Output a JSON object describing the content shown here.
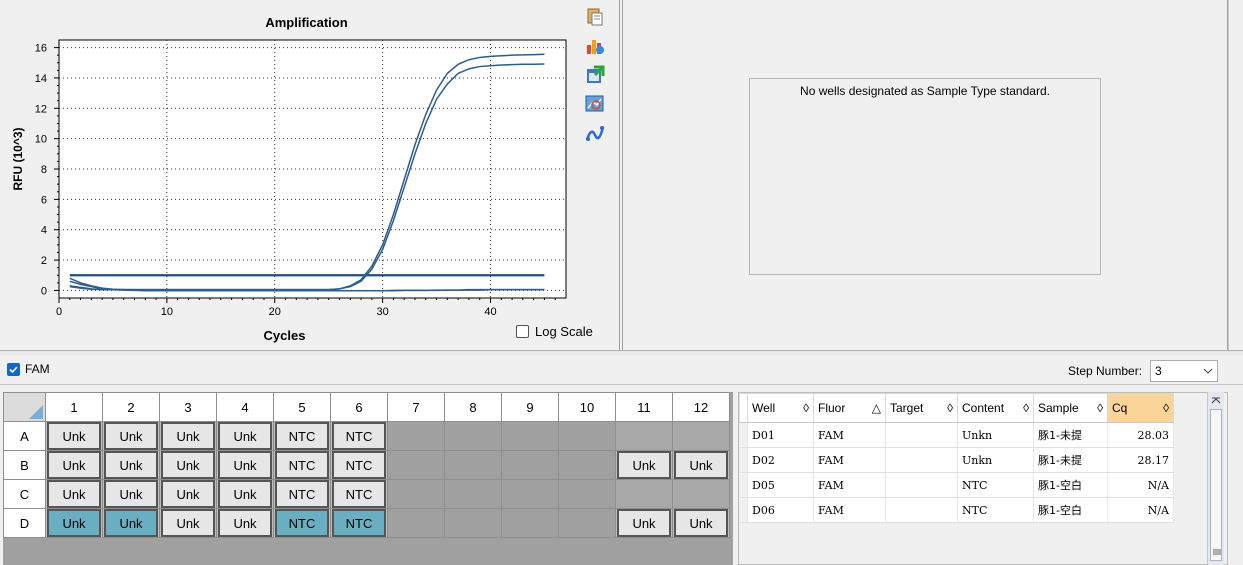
{
  "chart": {
    "log_scale_label": "Log Scale",
    "log_scale_checked": false,
    "tools": [
      "copy-icon",
      "chart-settings-icon",
      "export-icon",
      "zoom-icon",
      "trace-style-icon"
    ]
  },
  "chart_data": {
    "type": "line",
    "title": "Amplification",
    "xlabel": "Cycles",
    "ylabel": "RFU (10^3)",
    "xlim": [
      0,
      47
    ],
    "ylim": [
      -0.5,
      16.5
    ],
    "xticks": [
      0,
      10,
      20,
      30,
      40
    ],
    "yticks": [
      0,
      2,
      4,
      6,
      8,
      10,
      12,
      14,
      16
    ],
    "grid": true,
    "threshold": 1.0,
    "x_range": [
      1,
      45
    ],
    "series": [
      {
        "values": [
          0.25,
          0.15,
          0.08,
          0.05,
          0.05,
          0.05,
          0.05,
          0.05,
          0.05,
          0.05,
          0.05,
          0.05,
          0.05,
          0.05,
          0.05,
          0.05,
          0.05,
          0.05,
          0.05,
          0.05,
          0.05,
          0.05,
          0.05,
          0.05,
          0.05,
          0.1,
          0.25,
          0.6,
          1.4,
          2.7,
          4.6,
          6.8,
          9.0,
          11.0,
          12.6,
          13.6,
          14.3,
          14.6,
          14.75,
          14.8,
          14.85,
          14.88,
          14.9,
          14.9,
          14.92
        ]
      },
      {
        "values": [
          0.3,
          0.2,
          0.1,
          0.05,
          0.05,
          0.05,
          0.05,
          0.05,
          0.05,
          0.05,
          0.05,
          0.05,
          0.05,
          0.05,
          0.05,
          0.05,
          0.05,
          0.05,
          0.05,
          0.05,
          0.05,
          0.05,
          0.05,
          0.05,
          0.05,
          0.1,
          0.3,
          0.7,
          1.6,
          3.0,
          5.0,
          7.3,
          9.6,
          11.6,
          13.2,
          14.3,
          14.9,
          15.2,
          15.35,
          15.42,
          15.46,
          15.5,
          15.52,
          15.54,
          15.56
        ]
      },
      {
        "values": [
          0.8,
          0.5,
          0.3,
          0.15,
          0.08,
          0.05,
          0.02,
          0.0,
          0.0,
          -0.02,
          -0.02,
          -0.02,
          -0.02,
          -0.02,
          -0.02,
          -0.02,
          -0.02,
          -0.02,
          -0.02,
          -0.02,
          -0.02,
          -0.02,
          -0.02,
          -0.02,
          -0.02,
          -0.02,
          -0.02,
          -0.02,
          -0.02,
          -0.02,
          0.0,
          0.0,
          0.0,
          0.0,
          0.02,
          0.02,
          0.02,
          0.05,
          0.05,
          0.05,
          0.05,
          0.05,
          0.05,
          0.05,
          0.05
        ]
      },
      {
        "values": [
          0.6,
          0.4,
          0.25,
          0.12,
          0.05,
          0.02,
          0.0,
          -0.02,
          -0.02,
          -0.02,
          -0.02,
          -0.02,
          -0.02,
          -0.02,
          -0.02,
          -0.02,
          -0.02,
          -0.02,
          -0.02,
          -0.02,
          -0.02,
          -0.02,
          -0.02,
          -0.02,
          -0.02,
          -0.02,
          -0.02,
          -0.02,
          -0.02,
          -0.02,
          -0.02,
          0.0,
          0.0,
          0.0,
          0.0,
          0.02,
          0.02,
          0.02,
          0.02,
          0.05,
          0.05,
          0.05,
          0.05,
          0.05,
          0.05
        ]
      }
    ],
    "colors": {
      "curve": "#2d5c8e",
      "threshold": "#1f4f86"
    }
  },
  "standard_curve": {
    "message": "No wells designated as Sample Type standard."
  },
  "fluor": {
    "name": "FAM",
    "checked": true
  },
  "step": {
    "label": "Step Number:",
    "value": "3"
  },
  "plate": {
    "columns": [
      "1",
      "2",
      "3",
      "4",
      "5",
      "6",
      "7",
      "8",
      "9",
      "10",
      "11",
      "12"
    ],
    "rows": [
      {
        "label": "A",
        "cells": [
          "Unk",
          "Unk",
          "Unk",
          "Unk",
          "NTC",
          "NTC",
          "",
          "",
          "",
          "",
          "",
          ""
        ],
        "selected": []
      },
      {
        "label": "B",
        "cells": [
          "Unk",
          "Unk",
          "Unk",
          "Unk",
          "NTC",
          "NTC",
          "",
          "",
          "",
          "",
          "Unk",
          "Unk"
        ],
        "selected": []
      },
      {
        "label": "C",
        "cells": [
          "Unk",
          "Unk",
          "Unk",
          "Unk",
          "NTC",
          "NTC",
          "",
          "",
          "",
          "",
          "",
          ""
        ],
        "selected": []
      },
      {
        "label": "D",
        "cells": [
          "Unk",
          "Unk",
          "Unk",
          "Unk",
          "NTC",
          "NTC",
          "",
          "",
          "",
          "",
          "Unk",
          "Unk"
        ],
        "selected": [
          0,
          1,
          4,
          5
        ]
      }
    ]
  },
  "wells_table": {
    "headers": [
      {
        "label": "Well",
        "sort": "◊"
      },
      {
        "label": "Fluor",
        "sort": "△"
      },
      {
        "label": "Target",
        "sort": "◊"
      },
      {
        "label": "Content",
        "sort": "◊"
      },
      {
        "label": "Sample",
        "sort": "◊"
      },
      {
        "label": "Cq",
        "sort": "◊",
        "sorted": true
      }
    ],
    "rows": [
      {
        "well": "D01",
        "fluor": "FAM",
        "target": "",
        "content": "Unkn",
        "sample": "豚1-未提",
        "cq": "28.03"
      },
      {
        "well": "D02",
        "fluor": "FAM",
        "target": "",
        "content": "Unkn",
        "sample": "豚1-未提",
        "cq": "28.17"
      },
      {
        "well": "D05",
        "fluor": "FAM",
        "target": "",
        "content": "NTC",
        "sample": "豚1-空白",
        "cq": "N/A"
      },
      {
        "well": "D06",
        "fluor": "FAM",
        "target": "",
        "content": "NTC",
        "sample": "豚1-空白",
        "cq": "N/A"
      }
    ]
  }
}
